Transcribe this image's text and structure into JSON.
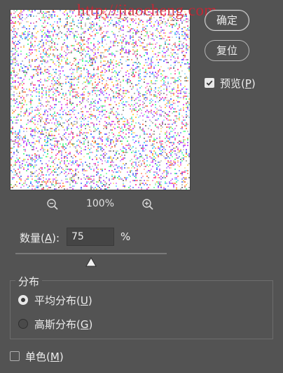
{
  "dialog": {
    "zoom_out_icon": "zoom-out-icon",
    "zoom_in_icon": "zoom-in-icon",
    "zoom_level": "100%",
    "watermark": "http://jiaocheng.com"
  },
  "buttons": {
    "ok_label": "确定",
    "reset_label": "复位"
  },
  "preview": {
    "label_prefix": "预览(",
    "label_key": "P",
    "label_suffix": ")",
    "checked": true
  },
  "amount": {
    "label_prefix": "数量(",
    "label_key": "A",
    "label_suffix": "):",
    "value": "75",
    "unit": "%",
    "slider_fraction": 0.5
  },
  "distribution": {
    "title": "分布",
    "options": [
      {
        "label_prefix": "平均分布(",
        "label_key": "U",
        "label_suffix": ")",
        "selected": true
      },
      {
        "label_prefix": "高斯分布(",
        "label_key": "G",
        "label_suffix": ")",
        "selected": false
      }
    ]
  },
  "monochrome": {
    "label_prefix": "单色(",
    "label_key": "M",
    "label_suffix": ")",
    "checked": false
  },
  "colors": {
    "panel_bg": "#535353",
    "text": "#ececec",
    "watermark": "#d62030"
  }
}
